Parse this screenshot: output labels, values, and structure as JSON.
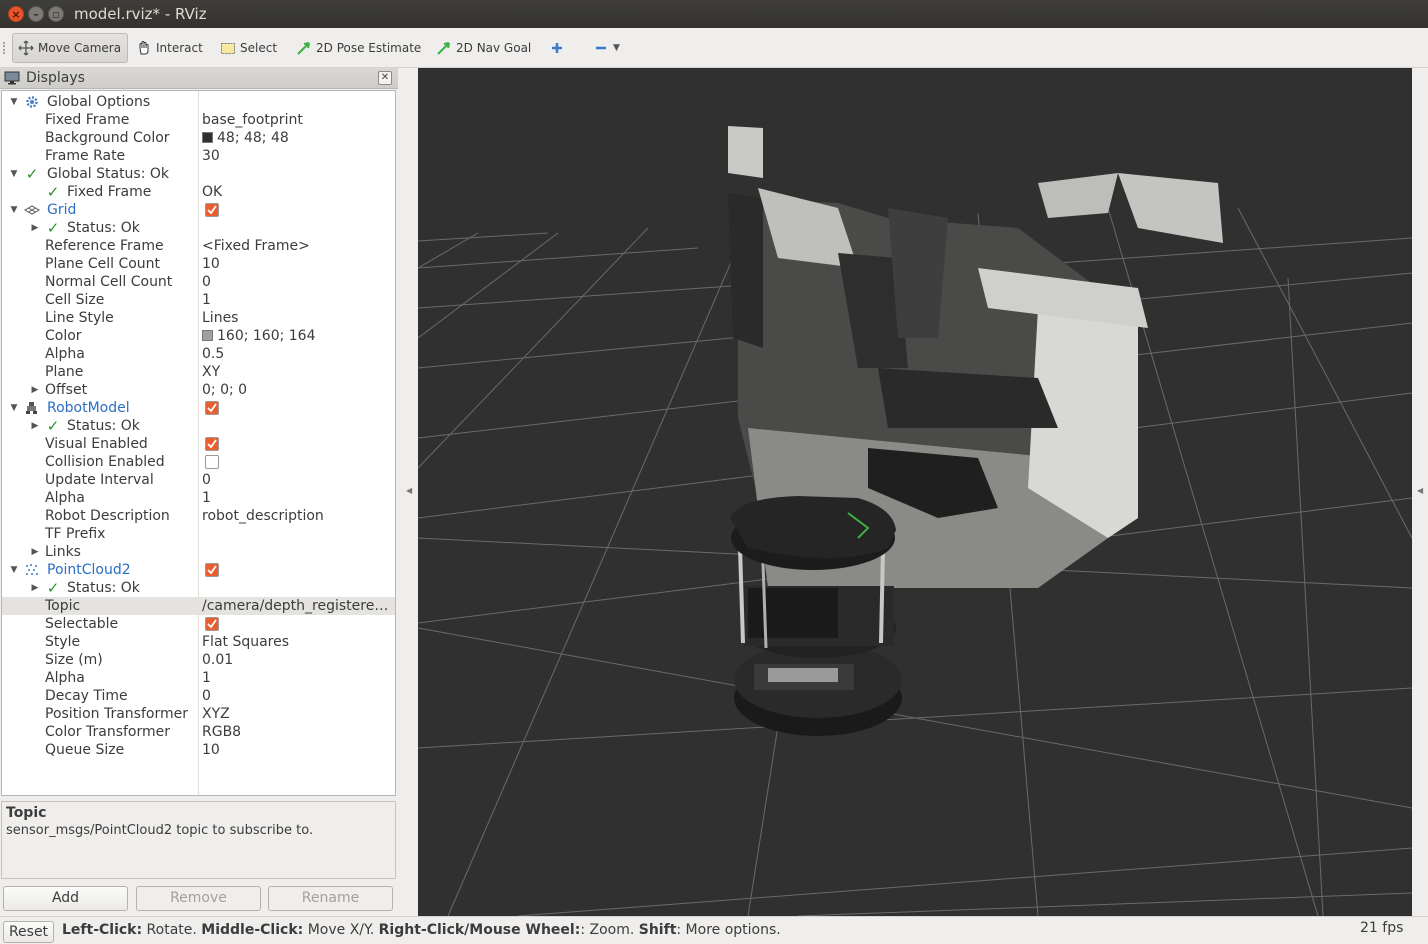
{
  "window": {
    "title": "model.rviz* - RViz"
  },
  "toolbar": {
    "move_camera": "Move Camera",
    "interact": "Interact",
    "select": "Select",
    "pose_estimate": "2D Pose Estimate",
    "nav_goal": "2D Nav Goal"
  },
  "displays": {
    "title": "Displays",
    "global_options": {
      "label": "Global Options",
      "fixed_frame_label": "Fixed Frame",
      "fixed_frame": "base_footprint",
      "background_color_label": "Background Color",
      "background_color": "48; 48; 48",
      "frame_rate_label": "Frame Rate",
      "frame_rate": "30"
    },
    "global_status": {
      "label": "Global Status: Ok",
      "fixed_frame_label": "Fixed Frame",
      "fixed_frame": "OK"
    },
    "grid": {
      "label": "Grid",
      "status": "Status: Ok",
      "reference_frame_label": "Reference Frame",
      "reference_frame": "<Fixed Frame>",
      "plane_cell_count_label": "Plane Cell Count",
      "plane_cell_count": "10",
      "normal_cell_count_label": "Normal Cell Count",
      "normal_cell_count": "0",
      "cell_size_label": "Cell Size",
      "cell_size": "1",
      "line_style_label": "Line Style",
      "line_style": "Lines",
      "color_label": "Color",
      "color": "160; 160; 164",
      "alpha_label": "Alpha",
      "alpha": "0.5",
      "plane_label": "Plane",
      "plane": "XY",
      "offset_label": "Offset",
      "offset": "0; 0; 0"
    },
    "robot_model": {
      "label": "RobotModel",
      "status": "Status: Ok",
      "visual_enabled_label": "Visual Enabled",
      "collision_enabled_label": "Collision Enabled",
      "update_interval_label": "Update Interval",
      "update_interval": "0",
      "alpha_label": "Alpha",
      "alpha": "1",
      "robot_description_label": "Robot Description",
      "robot_description": "robot_description",
      "tf_prefix_label": "TF Prefix",
      "links_label": "Links"
    },
    "point_cloud": {
      "label": "PointCloud2",
      "status": "Status: Ok",
      "topic_label": "Topic",
      "topic": "/camera/depth_registere…",
      "selectable_label": "Selectable",
      "style_label": "Style",
      "style": "Flat Squares",
      "size_label": "Size (m)",
      "size": "0.01",
      "alpha_label": "Alpha",
      "alpha": "1",
      "decay_time_label": "Decay Time",
      "decay_time": "0",
      "position_transformer_label": "Position Transformer",
      "position_transformer": "XYZ",
      "color_transformer_label": "Color Transformer",
      "color_transformer": "RGB8",
      "queue_size_label": "Queue Size",
      "queue_size": "10"
    }
  },
  "description": {
    "title": "Topic",
    "text": "sensor_msgs/PointCloud2 topic to subscribe to."
  },
  "buttons": {
    "add": "Add",
    "remove": "Remove",
    "rename": "Rename"
  },
  "statusbar": {
    "reset": "Reset",
    "left_click": "Left-Click:",
    "rotate": " Rotate. ",
    "middle_click": "Middle-Click:",
    "move": " Move X/Y. ",
    "right_click": "Right-Click/Mouse Wheel:",
    "zoom": ": Zoom. ",
    "shift": "Shift",
    "more": ": More options.",
    "fps": "21 fps"
  },
  "colors": {
    "background": "#303030",
    "grid": "#a0a0a4",
    "accent": "#e95f2f",
    "link": "#2a6fc4",
    "ok": "#2f8f2f"
  }
}
